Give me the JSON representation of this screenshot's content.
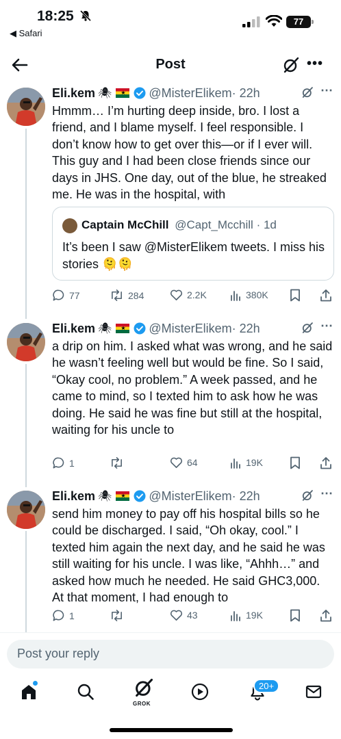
{
  "status_bar": {
    "time": "18:25",
    "back_app": "◀ Safari",
    "battery": "77"
  },
  "header": {
    "title": "Post"
  },
  "posts": [
    {
      "name": "Eli.kem",
      "handle": "@MisterElikem",
      "time": "· 22h",
      "text": "Hmmm… I’m hurting deep inside, bro. I lost a friend, and I blame myself. I feel responsible. I don’t know how to get over this—or if I ever will. This guy and I had been close friends since our days in JHS. One day, out of the blue, he streaked me. He was in the hospital, with",
      "quote": {
        "name": "Captain McChill",
        "handle": "@Capt_Mcchill",
        "time": "· 1d",
        "text": "It’s been I saw @MisterElikem tweets. I miss his stories",
        "emoji": "🫠🫠"
      },
      "replies": "77",
      "reposts": "284",
      "likes": "2.2K",
      "views": "380K"
    },
    {
      "name": "Eli.kem",
      "handle": "@MisterElikem",
      "time": "· 22h",
      "text": "a drip on him. I asked what was wrong, and he said he wasn’t feeling well but would be fine. So I said, “Okay cool, no problem.” A week passed, and he came to mind, so I texted him to ask how he was doing. He said he was fine but still at the hospital, waiting for his uncle to",
      "replies": "1",
      "reposts": "",
      "likes": "64",
      "views": "19K"
    },
    {
      "name": "Eli.kem",
      "handle": "@MisterElikem",
      "time": "· 22h",
      "text": "send him money to pay off his hospital bills so he could be discharged. I said, “Oh okay, cool.” I texted him again the next day, and he said he was still waiting for his uncle. I was like, “Ahhh…” and asked how much he needed. He said GHC3,000. At that moment, I had enough to",
      "replies": "1",
      "reposts": "",
      "likes": "43",
      "views": "19K"
    }
  ],
  "reply_bar": {
    "placeholder": "Post your reply"
  },
  "nav": {
    "grok_label": "GROK",
    "notifications_badge": "20+"
  },
  "colors": {
    "accent": "#1d9bf0",
    "secondary_text": "#536471",
    "border": "#cfd9de"
  }
}
